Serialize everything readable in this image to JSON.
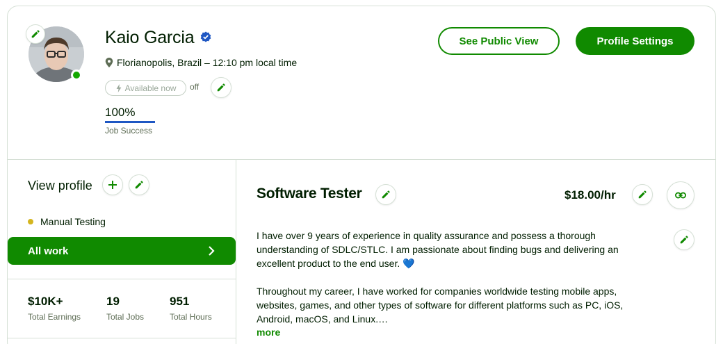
{
  "profile": {
    "name": "Kaio Garcia",
    "location": "Florianopolis, Brazil – 12:10 pm local time",
    "availability_label": "Available now",
    "availability_state": "off",
    "job_success_value": "100%",
    "job_success_label": "Job Success",
    "job_success_fraction": 1.0
  },
  "header_actions": {
    "public_view_label": "See Public View",
    "settings_label": "Profile Settings"
  },
  "sidebar": {
    "view_profile_label": "View profile",
    "skill": "Manual Testing",
    "all_work_label": "All work",
    "stats": [
      {
        "value": "$10K+",
        "label": "Total Earnings"
      },
      {
        "value": "19",
        "label": "Total Jobs"
      },
      {
        "value": "951",
        "label": "Total Hours"
      }
    ]
  },
  "main": {
    "title": "Software Tester",
    "rate": "$18.00/hr",
    "description_1": "I have over 9 years of experience in quality assurance and possess a thorough understanding of SDLC/STLC. I am passionate about finding bugs and delivering an excellent product to the end user.",
    "description_1_emoji": "💙",
    "description_2": "Throughout my career, I have worked for companies worldwide testing mobile apps, websites, games, and other types of software for different platforms such as PC, iOS, Android, macOS, and Linux.…",
    "more_label": "more"
  },
  "colors": {
    "brand_green": "#108a00",
    "online_green": "#14a800",
    "verified_blue": "#1f57c3",
    "skill_dot": "#d4b51e"
  },
  "icons": [
    "pencil-icon",
    "verified-badge-icon",
    "location-pin-icon",
    "bolt-icon",
    "plus-icon",
    "chevron-right-icon",
    "link-icon"
  ]
}
